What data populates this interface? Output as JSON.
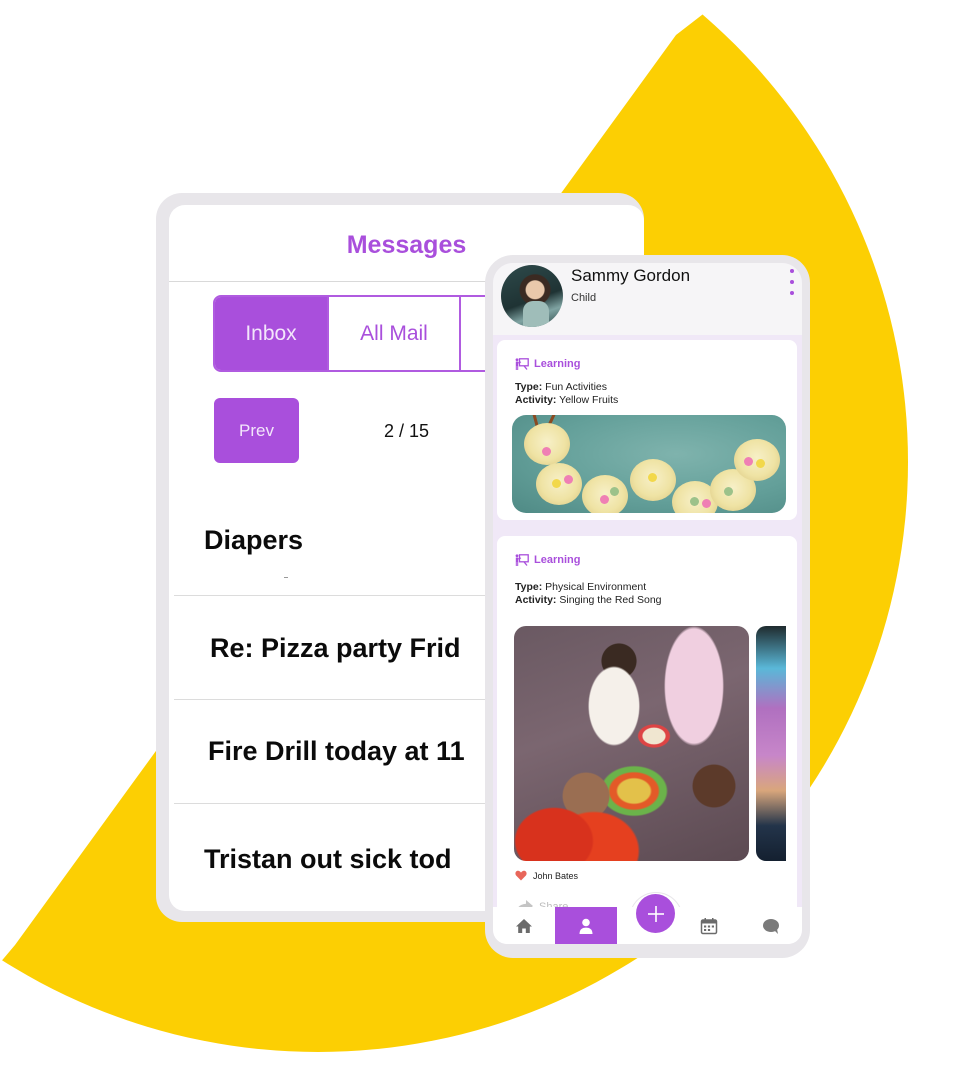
{
  "colors": {
    "accent": "#a94fdc",
    "background_shape": "#fccf03",
    "device_frame": "#e8e6ea",
    "heart": "#e8665a"
  },
  "messages_screen": {
    "title": "Messages",
    "tabs": [
      {
        "label": "Inbox",
        "active": true
      },
      {
        "label": "All Mail",
        "active": false
      },
      {
        "label": "",
        "active": false
      }
    ],
    "pagination": {
      "prev_label": "Prev",
      "indicator": "2 / 15",
      "current_page": 2,
      "total_pages": 15
    },
    "messages": [
      {
        "subject": "Diapers"
      },
      {
        "subject": "Re: Pizza party Frid"
      },
      {
        "subject": "Fire Drill today at 11"
      },
      {
        "subject": "Tristan out sick tod"
      }
    ]
  },
  "profile_screen": {
    "child_name": "Sammy Gordon",
    "child_role": "Child",
    "menu_icon": "kebab-menu-icon",
    "posts": [
      {
        "category": "Learning",
        "category_icon": "teacher-board-icon",
        "type_label": "Type:",
        "type_value": "Fun Activities",
        "activity_label": "Activity:",
        "activity_value": "Yellow Fruits",
        "photo": "banana caterpillar snack"
      },
      {
        "category": "Learning",
        "category_icon": "teacher-board-icon",
        "type_label": "Type:",
        "type_value": "Physical Environment",
        "activity_label": "Activity:",
        "activity_value": "Singing the Red Song",
        "photo": "children playing with instruments",
        "liked_by": "John Bates",
        "share_label": "Share"
      }
    ],
    "bottom_nav": [
      {
        "name": "home",
        "icon": "home-icon",
        "active": false
      },
      {
        "name": "profile",
        "icon": "person-icon",
        "active": true
      },
      {
        "name": "add",
        "icon": "plus-icon",
        "active": false
      },
      {
        "name": "calendar",
        "icon": "calendar-icon",
        "active": false
      },
      {
        "name": "chat",
        "icon": "chat-bubble-icon",
        "active": false
      }
    ]
  }
}
